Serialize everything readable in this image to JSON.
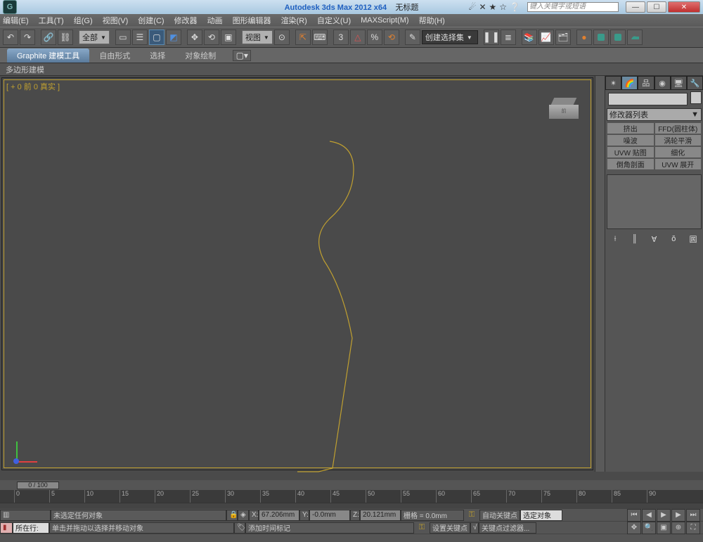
{
  "title": {
    "app": "Autodesk 3ds Max  2012 x64",
    "doc": "无标题"
  },
  "search_placeholder": "键入关键字或短语",
  "menu": [
    "编辑(E)",
    "工具(T)",
    "组(G)",
    "视图(V)",
    "创建(C)",
    "修改器",
    "动画",
    "图形编辑器",
    "渲染(R)",
    "自定义(U)",
    "MAXScript(M)",
    "帮助(H)"
  ],
  "toolbar": {
    "filter_label": "全部",
    "view_label": "视图",
    "seltool": "创建选择集"
  },
  "ribbon": {
    "tabs": [
      "Graphite 建模工具",
      "自由形式",
      "选择",
      "对象绘制"
    ],
    "sub": "多边形建模"
  },
  "viewport_label": "[ + 0 前 0 真实 ]",
  "cmd": {
    "modlist": "修改器列表",
    "btns": [
      [
        "挤出",
        "FFD(圆柱体)"
      ],
      [
        "噪波",
        "涡轮平滑"
      ],
      [
        "UVW 贴图",
        "细化"
      ],
      [
        "倒角剖面",
        "UVW 展开"
      ]
    ]
  },
  "timeline": {
    "pos": "0 / 100",
    "marks": [
      0,
      5,
      10,
      15,
      20,
      25,
      30,
      35,
      40,
      45,
      50,
      55,
      60,
      65,
      70,
      75,
      80,
      85,
      90
    ]
  },
  "status": {
    "r1": {
      "sel": "未选定任何对象",
      "x": "67.206mm",
      "y": "-0.0mm",
      "z": "20.121mm",
      "grid": "栅格 = 0.0mm",
      "autokey": "自动关键点",
      "selobj": "选定对象"
    },
    "r2": {
      "loc": "所在行:",
      "hint": "单击并拖动以选择并移动对象",
      "addtag": "添加时间标记",
      "setkey": "设置关键点",
      "keyfilter": "关键点过滤器..."
    },
    "xl": "X:",
    "yl": "Y:",
    "zl": "Z:"
  }
}
